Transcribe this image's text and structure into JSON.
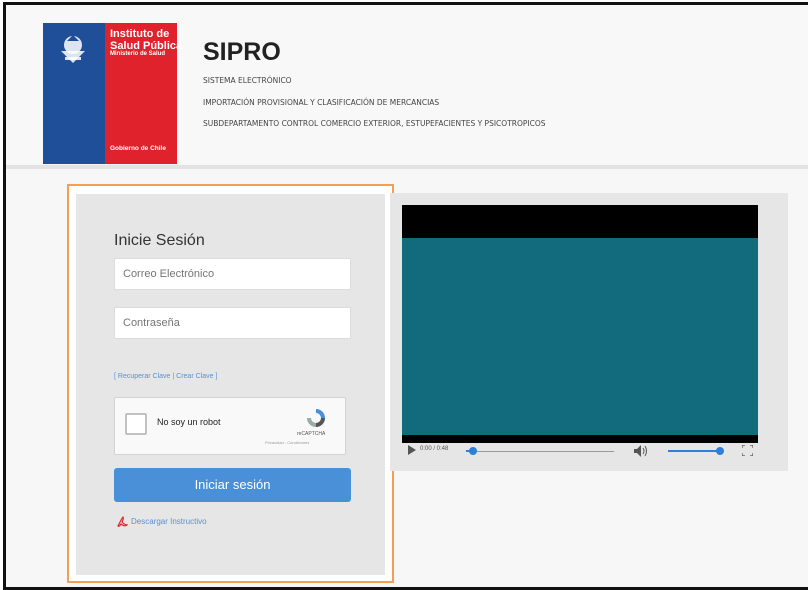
{
  "header": {
    "logo": {
      "line1": "Instituto de",
      "line2": "Salud Pública",
      "ministry": "Ministerio de Salud",
      "government": "Gobierno de Chile"
    },
    "title": "SIPRO",
    "subtitle1": "SISTEMA ELECTRÓNICO",
    "subtitle2": "IMPORTACIÓN PROVISIONAL Y CLASIFICACIÓN DE MERCANCIAS",
    "subtitle3": "SUBDEPARTAMENTO CONTROL COMERCIO EXTERIOR, ESTUPEFACIENTES Y PSICOTROPICOS"
  },
  "login": {
    "title": "Inicie Sesión",
    "email_placeholder": "Correo Electrónico",
    "password_placeholder": "Contraseña",
    "bracket_open": "[ ",
    "recover_label": "Recuperar Clave",
    "separator": " | ",
    "create_label": "Crear Clave",
    "bracket_close": " ]",
    "captcha_label": "No soy un robot",
    "captcha_brand": "reCAPTCHA",
    "captcha_terms": "Privacidad - Condiciones",
    "submit_label": "Iniciar sesión",
    "download_label": "Descargar Instructivo"
  },
  "video": {
    "time": "0:00 / 0:48",
    "progress": 0.05,
    "volume": 1.0
  },
  "colors": {
    "accent": "#4a90d9",
    "video_bg": "#116b7d",
    "highlight": "#f1a055",
    "logo_blue": "#1f4f99",
    "logo_red": "#e0222d"
  }
}
